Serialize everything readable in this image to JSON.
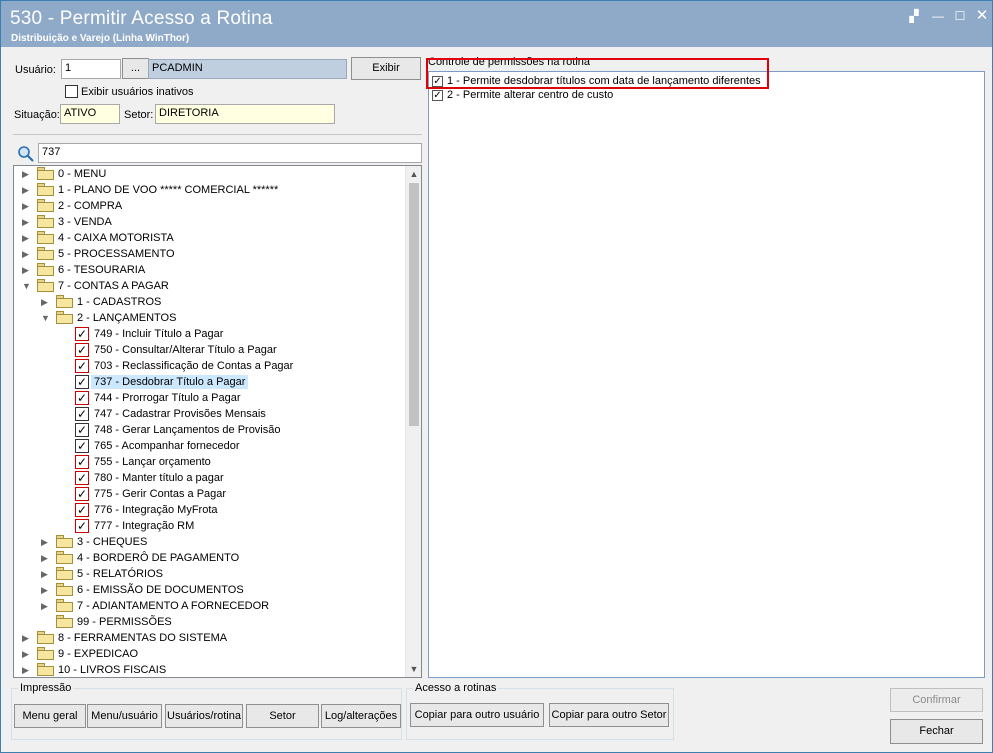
{
  "window": {
    "title": "530 - Permitir Acesso a Rotina",
    "subtitle": "Distribuição e Varejo (Linha WinThor)",
    "controls": {
      "restore": "▞",
      "minimize": "—",
      "maximize": "☐",
      "close": "✕"
    }
  },
  "user": {
    "label": "Usuário:",
    "code": "1",
    "lookup": "...",
    "name": "PCADMIN",
    "show_button": "Exibir",
    "inactive_label": "Exibir usuários inativos",
    "inactive_checked": false,
    "situation_label": "Situação:",
    "situation_value": "ATIVO",
    "sector_label": "Setor:",
    "sector_value": "DIRETORIA"
  },
  "search": {
    "icon": "search-icon",
    "value": "737"
  },
  "tree": {
    "nodes": [
      {
        "label": "0 - MENU",
        "level": 0,
        "type": "folder",
        "expanded": false
      },
      {
        "label": "1 - PLANO DE VOO   *****   COMERCIAL ******",
        "level": 0,
        "type": "folder",
        "expanded": false
      },
      {
        "label": "2 - COMPRA",
        "level": 0,
        "type": "folder",
        "expanded": false
      },
      {
        "label": "3 - VENDA",
        "level": 0,
        "type": "folder",
        "expanded": false
      },
      {
        "label": "4 - CAIXA MOTORISTA",
        "level": 0,
        "type": "folder",
        "expanded": false
      },
      {
        "label": "5 - PROCESSAMENTO",
        "level": 0,
        "type": "folder",
        "expanded": false
      },
      {
        "label": "6 - TESOURARIA",
        "level": 0,
        "type": "folder",
        "expanded": false
      },
      {
        "label": "7 - CONTAS A PAGAR",
        "level": 0,
        "type": "folder",
        "expanded": true
      },
      {
        "label": "1 - CADASTROS",
        "level": 1,
        "type": "folder",
        "expanded": false
      },
      {
        "label": "2 - LANÇAMENTOS",
        "level": 1,
        "type": "folder",
        "expanded": true
      },
      {
        "label": "749 - Incluir Título a Pagar",
        "level": 2,
        "type": "check",
        "check_style": "red",
        "checked": true
      },
      {
        "label": "750 - Consultar/Alterar Título a Pagar",
        "level": 2,
        "type": "check",
        "check_style": "red",
        "checked": true
      },
      {
        "label": "703 - Reclassificação de Contas a Pagar",
        "level": 2,
        "type": "check",
        "check_style": "red",
        "checked": true
      },
      {
        "label": "737 - Desdobrar Título a Pagar",
        "level": 2,
        "type": "check",
        "check_style": "black",
        "checked": true,
        "selected": true
      },
      {
        "label": "744 - Prorrogar Título a Pagar",
        "level": 2,
        "type": "check",
        "check_style": "red",
        "checked": true
      },
      {
        "label": "747 - Cadastrar Provisões Mensais",
        "level": 2,
        "type": "check",
        "check_style": "black",
        "checked": true
      },
      {
        "label": "748 - Gerar Lançamentos de Provisão",
        "level": 2,
        "type": "check",
        "check_style": "black",
        "checked": true
      },
      {
        "label": "765 - Acompanhar fornecedor",
        "level": 2,
        "type": "check",
        "check_style": "black",
        "checked": true
      },
      {
        "label": "755 - Lançar orçamento",
        "level": 2,
        "type": "check",
        "check_style": "red",
        "checked": true
      },
      {
        "label": "780 - Manter título a pagar",
        "level": 2,
        "type": "check",
        "check_style": "red",
        "checked": true
      },
      {
        "label": "775 - Gerir Contas a Pagar",
        "level": 2,
        "type": "check",
        "check_style": "red",
        "checked": true
      },
      {
        "label": "776 - Integração MyFrota",
        "level": 2,
        "type": "check",
        "check_style": "red",
        "checked": true
      },
      {
        "label": "777 - Integração RM",
        "level": 2,
        "type": "check",
        "check_style": "red",
        "checked": true
      },
      {
        "label": "3 - CHEQUES",
        "level": 1,
        "type": "folder",
        "expanded": false
      },
      {
        "label": "4 - BORDERÔ DE PAGAMENTO",
        "level": 1,
        "type": "folder",
        "expanded": false
      },
      {
        "label": "5 - RELATÓRIOS",
        "level": 1,
        "type": "folder",
        "expanded": false
      },
      {
        "label": "6 - EMISSÃO DE DOCUMENTOS",
        "level": 1,
        "type": "folder",
        "expanded": false
      },
      {
        "label": "7 - ADIANTAMENTO A FORNECEDOR",
        "level": 1,
        "type": "folder",
        "expanded": false
      },
      {
        "label": "99 - PERMISSÕES",
        "level": 1,
        "type": "folder",
        "expanded": false,
        "no_arrow": true
      },
      {
        "label": "8 - FERRAMENTAS DO SISTEMA",
        "level": 0,
        "type": "folder",
        "expanded": false
      },
      {
        "label": "9 - EXPEDICAO",
        "level": 0,
        "type": "folder",
        "expanded": false
      },
      {
        "label": "10 - LIVROS FISCAIS",
        "level": 0,
        "type": "folder",
        "expanded": false
      }
    ]
  },
  "permissions": {
    "title": "Controle de permissões na rotina",
    "items": [
      {
        "label": "1 - Permite desdobrar títulos com data de lançamento diferentes",
        "checked": true,
        "highlighted": true
      },
      {
        "label": "2 - Permite alterar centro de custo",
        "checked": true,
        "highlighted": false
      }
    ],
    "highlight_color": "#e0000b"
  },
  "print_group": {
    "title": "Impressão",
    "buttons": [
      "Menu geral",
      "Menu/usuário",
      "Usuários/rotina",
      "Setor",
      "Log/alterações"
    ]
  },
  "access_group": {
    "title": "Acesso a rotinas",
    "buttons": [
      "Copiar para outro usuário",
      "Copiar para outro Setor"
    ]
  },
  "actions": {
    "confirm": "Confirmar",
    "close": "Fechar"
  },
  "colors": {
    "titlebar": "#8faac8",
    "selection": "#cce8ff",
    "check_red": "#c00000"
  }
}
